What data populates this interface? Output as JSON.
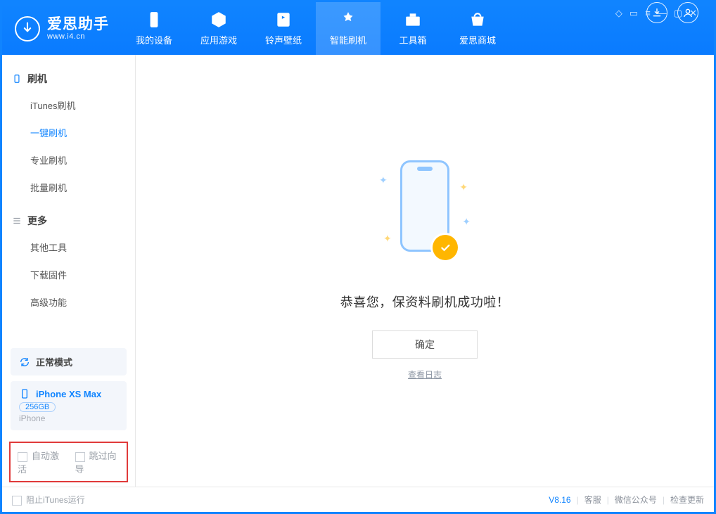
{
  "header": {
    "app_title": "爱思助手",
    "app_subtitle": "www.i4.cn",
    "tabs": [
      {
        "label": "我的设备"
      },
      {
        "label": "应用游戏"
      },
      {
        "label": "铃声壁纸"
      },
      {
        "label": "智能刷机"
      },
      {
        "label": "工具箱"
      },
      {
        "label": "爱思商城"
      }
    ]
  },
  "sidebar": {
    "groups": [
      {
        "title": "刷机",
        "items": [
          {
            "label": "iTunes刷机"
          },
          {
            "label": "一键刷机",
            "active": true
          },
          {
            "label": "专业刷机"
          },
          {
            "label": "批量刷机"
          }
        ]
      },
      {
        "title": "更多",
        "items": [
          {
            "label": "其他工具"
          },
          {
            "label": "下载固件"
          },
          {
            "label": "高级功能"
          }
        ]
      }
    ],
    "mode_block": {
      "label": "正常模式"
    },
    "device_block": {
      "name": "iPhone XS Max",
      "storage": "256GB",
      "type": "iPhone"
    },
    "options": {
      "auto_activate": "自动激活",
      "skip_guide": "跳过向导"
    }
  },
  "main": {
    "success_msg": "恭喜您，保资料刷机成功啦！",
    "ok_button": "确定",
    "view_log": "查看日志"
  },
  "statusbar": {
    "block_itunes": "阻止iTunes运行",
    "version": "V8.16",
    "links": {
      "support": "客服",
      "wechat": "微信公众号",
      "update": "检查更新"
    }
  }
}
